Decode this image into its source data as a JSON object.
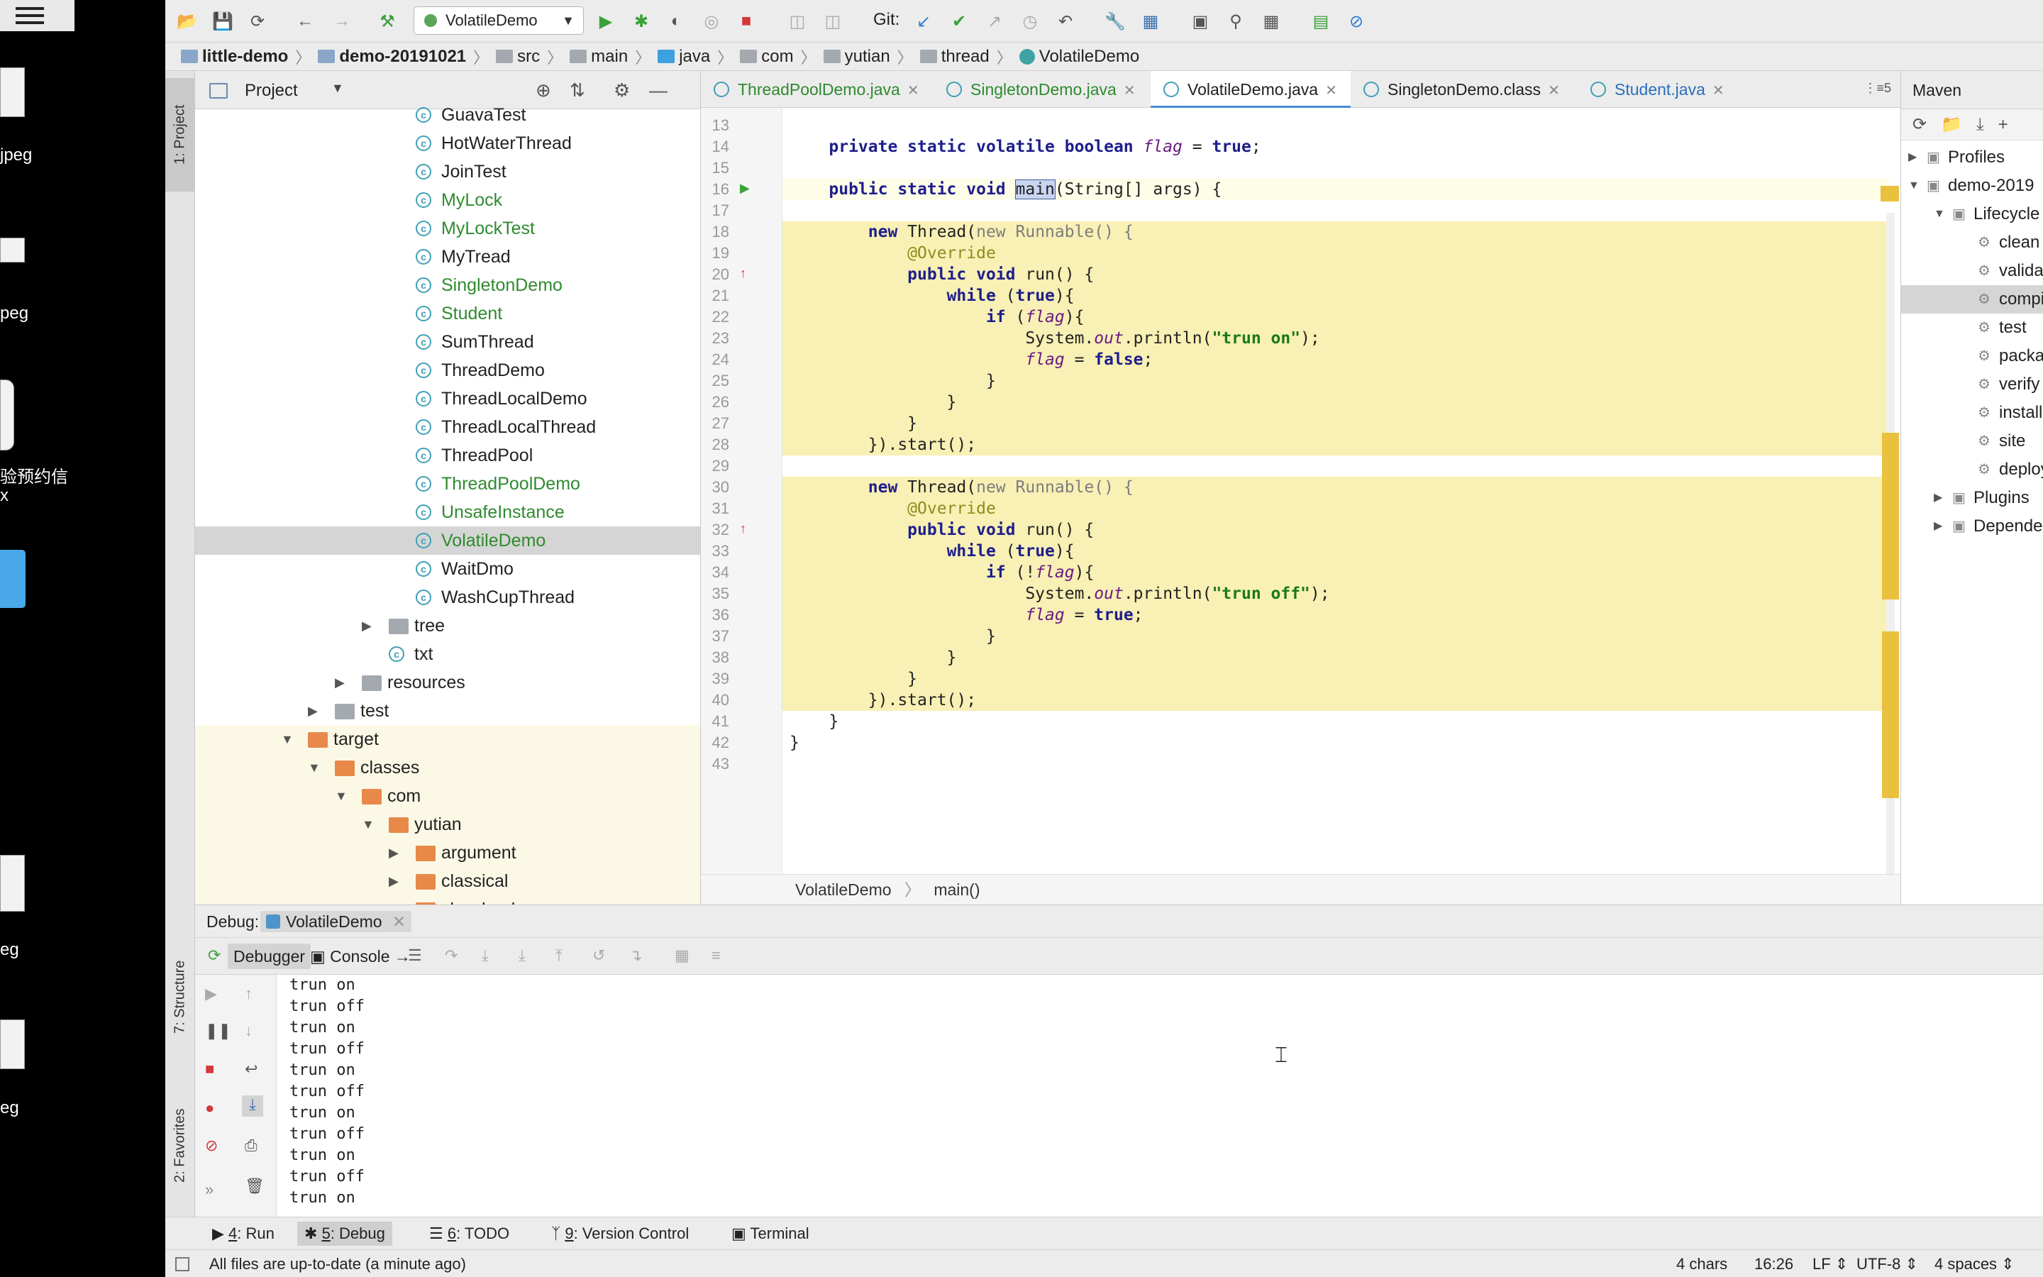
{
  "desktop": {
    "items": [
      "jpeg",
      "peg",
      "验预约信",
      "x",
      "eg",
      "eg"
    ]
  },
  "toolbar": {
    "run_config": "VolatileDemo",
    "git_label": "Git:"
  },
  "breadcrumb": [
    "little-demo",
    "demo-20191021",
    "src",
    "main",
    "java",
    "com",
    "yutian",
    "thread",
    "VolatileDemo"
  ],
  "left_stripe": {
    "project_tab": "1: Project",
    "structure_tab": "7: Structure",
    "favorites_tab": "2: Favorites"
  },
  "project": {
    "title": "Project",
    "tree": [
      {
        "label": "GuavaTest",
        "type": "class",
        "indent": 2,
        "color": "normal"
      },
      {
        "label": "HotWaterThread",
        "type": "class",
        "indent": 2,
        "color": "normal"
      },
      {
        "label": "JoinTest",
        "type": "class",
        "indent": 2,
        "color": "normal"
      },
      {
        "label": "MyLock",
        "type": "class",
        "indent": 2,
        "color": "green"
      },
      {
        "label": "MyLockTest",
        "type": "class",
        "indent": 2,
        "color": "green"
      },
      {
        "label": "MyTread",
        "type": "class",
        "indent": 2,
        "color": "normal"
      },
      {
        "label": "SingletonDemo",
        "type": "class",
        "indent": 2,
        "color": "green"
      },
      {
        "label": "Student",
        "type": "class",
        "indent": 2,
        "color": "green"
      },
      {
        "label": "SumThread",
        "type": "class",
        "indent": 2,
        "color": "normal"
      },
      {
        "label": "ThreadDemo",
        "type": "class",
        "indent": 2,
        "color": "normal"
      },
      {
        "label": "ThreadLocalDemo",
        "type": "class",
        "indent": 2,
        "color": "normal"
      },
      {
        "label": "ThreadLocalThread",
        "type": "class",
        "indent": 2,
        "color": "normal"
      },
      {
        "label": "ThreadPool",
        "type": "class",
        "indent": 2,
        "color": "normal"
      },
      {
        "label": "ThreadPoolDemo",
        "type": "class",
        "indent": 2,
        "color": "green"
      },
      {
        "label": "UnsafeInstance",
        "type": "class",
        "indent": 2,
        "color": "green"
      },
      {
        "label": "VolatileDemo",
        "type": "class",
        "indent": 2,
        "color": "green",
        "selected": true
      },
      {
        "label": "WaitDmo",
        "type": "class",
        "indent": 2,
        "color": "normal"
      },
      {
        "label": "WashCupThread",
        "type": "class",
        "indent": 2,
        "color": "normal"
      },
      {
        "label": "tree",
        "type": "folder-grey",
        "indent": 1,
        "expander": "collapsed",
        "color": "normal"
      },
      {
        "label": "txt",
        "type": "class",
        "indent": 1,
        "color": "normal"
      },
      {
        "label": "resources",
        "type": "folder-grey",
        "indent": 0,
        "expander": "collapsed",
        "color": "normal"
      },
      {
        "label": "test",
        "type": "folder-grey",
        "indent": -1,
        "expander": "collapsed",
        "color": "normal"
      },
      {
        "label": "target",
        "type": "folder-orange",
        "indent": -2,
        "expander": "expanded",
        "color": "normal",
        "yellow": true
      },
      {
        "label": "classes",
        "type": "folder-orange",
        "indent": -1,
        "expander": "expanded",
        "color": "normal",
        "yellow": true
      },
      {
        "label": "com",
        "type": "folder-orange",
        "indent": 0,
        "expander": "expanded",
        "color": "normal",
        "yellow": true
      },
      {
        "label": "yutian",
        "type": "folder-orange",
        "indent": 1,
        "expander": "expanded",
        "color": "normal",
        "yellow": true
      },
      {
        "label": "argument",
        "type": "folder-orange",
        "indent": 2,
        "expander": "collapsed",
        "color": "normal",
        "yellow": true
      },
      {
        "label": "classical",
        "type": "folder-orange",
        "indent": 2,
        "expander": "collapsed",
        "color": "normal",
        "yellow": true
      },
      {
        "label": "classload",
        "type": "folder-orange",
        "indent": 2,
        "expander": "collapsed",
        "color": "normal",
        "yellow": true
      }
    ]
  },
  "editor": {
    "tabs": [
      {
        "label": "ThreadPoolDemo.java",
        "style": "green"
      },
      {
        "label": "SingletonDemo.java",
        "style": "green"
      },
      {
        "label": "VolatileDemo.java",
        "style": "active"
      },
      {
        "label": "SingletonDemo.class",
        "style": "plain"
      },
      {
        "label": "Student.java",
        "style": "blue"
      }
    ],
    "tab_overflow": "5",
    "lines": [
      {
        "n": "13",
        "html": ""
      },
      {
        "n": "14",
        "html": "    <span class='kw'>private static volatile boolean</span> <span class='it'>flag</span> = <span class='kw'>true</span>;"
      },
      {
        "n": "15",
        "html": ""
      },
      {
        "n": "16",
        "html": "    <span class='kw'>public static void</span> <span class='selword'>main</span>(String[] args) {",
        "cur": true
      },
      {
        "n": "17",
        "html": ""
      },
      {
        "n": "18",
        "html": "        <span class='kw'>new</span> Thread(<span class='gr'>new Runnable() {</span>",
        "hl": true
      },
      {
        "n": "19",
        "html": "            <span class='an'>@Override</span>",
        "hl": true
      },
      {
        "n": "20",
        "html": "            <span class='kw'>public void</span> run() {",
        "hl": true
      },
      {
        "n": "21",
        "html": "                <span class='kw'>while</span> (<span class='kw'>true</span>){",
        "hl": true
      },
      {
        "n": "22",
        "html": "                    <span class='kw'>if</span> (<span class='it'>flag</span>){",
        "hl": true
      },
      {
        "n": "23",
        "html": "                        System.<span class='it'>out</span>.println(<span class='st'>\"trun on\"</span>);",
        "hl": true
      },
      {
        "n": "24",
        "html": "                        <span class='it'>flag</span> = <span class='kw'>false</span>;",
        "hl": true
      },
      {
        "n": "25",
        "html": "                    }",
        "hl": true
      },
      {
        "n": "26",
        "html": "                }",
        "hl": true
      },
      {
        "n": "27",
        "html": "            }",
        "hl": true
      },
      {
        "n": "28",
        "html": "        }).start();",
        "hl": true
      },
      {
        "n": "29",
        "html": ""
      },
      {
        "n": "30",
        "html": "        <span class='kw'>new</span> Thread(<span class='gr'>new Runnable() {</span>",
        "hl": true
      },
      {
        "n": "31",
        "html": "            <span class='an'>@Override</span>",
        "hl": true
      },
      {
        "n": "32",
        "html": "            <span class='kw'>public void</span> run() {",
        "hl": true
      },
      {
        "n": "33",
        "html": "                <span class='kw'>while</span> (<span class='kw'>true</span>){",
        "hl": true
      },
      {
        "n": "34",
        "html": "                    <span class='kw'>if</span> (!<span class='it'>flag</span>){",
        "hl": true
      },
      {
        "n": "35",
        "html": "                        System.<span class='it'>out</span>.println(<span class='st'>\"trun off\"</span>);",
        "hl": true
      },
      {
        "n": "36",
        "html": "                        <span class='it'>flag</span> = <span class='kw'>true</span>;",
        "hl": true
      },
      {
        "n": "37",
        "html": "                    }",
        "hl": true
      },
      {
        "n": "38",
        "html": "                }",
        "hl": true
      },
      {
        "n": "39",
        "html": "            }",
        "hl": true
      },
      {
        "n": "40",
        "html": "        }).start();",
        "hl": true
      },
      {
        "n": "41",
        "html": "    }"
      },
      {
        "n": "42",
        "html": "}"
      },
      {
        "n": "43",
        "html": ""
      }
    ],
    "breadcrumb_class": "VolatileDemo",
    "breadcrumb_method": "main()"
  },
  "maven": {
    "title": "Maven",
    "rows": [
      {
        "label": "Profiles",
        "indent": 0,
        "expander": "collapsed"
      },
      {
        "label": "demo-2019",
        "indent": 0,
        "expander": "expanded"
      },
      {
        "label": "Lifecycle",
        "indent": 1,
        "expander": "expanded"
      },
      {
        "label": "clean",
        "indent": 2
      },
      {
        "label": "validate",
        "indent": 2
      },
      {
        "label": "compile",
        "indent": 2,
        "selected": true
      },
      {
        "label": "test",
        "indent": 2
      },
      {
        "label": "package",
        "indent": 2
      },
      {
        "label": "verify",
        "indent": 2
      },
      {
        "label": "install",
        "indent": 2
      },
      {
        "label": "site",
        "indent": 2
      },
      {
        "label": "deploy",
        "indent": 2
      },
      {
        "label": "Plugins",
        "indent": 1,
        "expander": "collapsed"
      },
      {
        "label": "Dependencies",
        "indent": 1,
        "expander": "collapsed"
      }
    ]
  },
  "debug": {
    "label": "Debug:",
    "session": "VolatileDemo",
    "debugger_tab": "Debugger",
    "console_tab": "Console",
    "output": [
      "trun on",
      "trun off",
      "trun on",
      "trun off",
      "trun on",
      "trun off",
      "trun on",
      "trun off",
      "trun on",
      "trun off",
      "trun on"
    ]
  },
  "bottom_tabs": [
    {
      "key": "4",
      "label": ": Run"
    },
    {
      "key": "5",
      "label": ": Debug",
      "active": true
    },
    {
      "key": "6",
      "label": ": TODO"
    },
    {
      "key": "9",
      "label": ": Version Control"
    },
    {
      "key": "",
      "label": "Terminal"
    }
  ],
  "status": {
    "message": "All files are up-to-date (a minute ago)",
    "chars": "4 chars",
    "position": "16:26",
    "line_sep": "LF",
    "encoding": "UTF-8",
    "indent": "4 spaces"
  }
}
